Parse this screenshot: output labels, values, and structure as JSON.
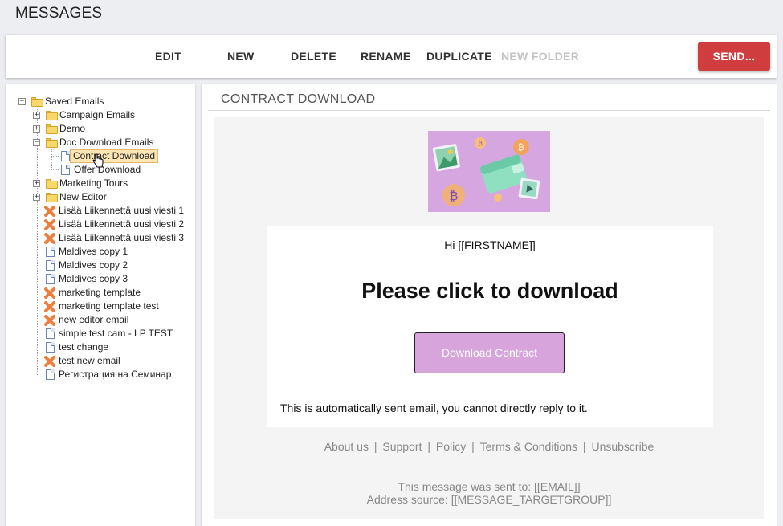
{
  "page": {
    "title": "MESSAGES"
  },
  "toolbar": {
    "edit": "EDIT",
    "new": "NEW",
    "delete": "DELETE",
    "rename": "RENAME",
    "duplicate": "DUPLICATE",
    "new_folder": "NEW FOLDER",
    "send": "SEND..."
  },
  "tree": {
    "root": "Saved Emails",
    "folders": {
      "campaign": "Campaign Emails",
      "demo": "Demo",
      "doc_download": "Doc Download Emails",
      "marketing_tours": "Marketing Tours",
      "new_editor": "New Editor"
    },
    "doc_children": [
      "Contract Download",
      "Offer Download"
    ],
    "items": [
      "Lisää Liikennettä uusi viesti 1",
      "Lisää Liikennettä uusi viesti 2",
      "Lisää Liikennettä uusi viesti 3",
      "Maldives copy 1",
      "Maldives copy 2",
      "Maldives copy 3",
      "marketing template",
      "marketing template test",
      "new editor email",
      "simple test cam - LP TEST",
      "test change",
      "test new email",
      "Регистрация на Семинар"
    ],
    "selected": "Contract Download"
  },
  "main": {
    "title": "CONTRACT DOWNLOAD",
    "email": {
      "greeting": "Hi [[FIRSTNAME]]",
      "headline": "Please click to download",
      "button": "Download Contract",
      "note": "This is automatically sent email, you cannot directly reply to it.",
      "footer_links": [
        "About us",
        "Support",
        "Policy",
        "Terms & Conditions",
        "Unsubscribe"
      ],
      "sent_to": "This message was sent to: [[EMAIL]]",
      "address_source": "Address source: [[MESSAGE_TARGETGROUP]]"
    }
  },
  "colors": {
    "send": "#cf3d3e",
    "hero_bg": "#d6a6e0",
    "download_button": "#d7a4dc",
    "selection": "#fde6b3"
  }
}
